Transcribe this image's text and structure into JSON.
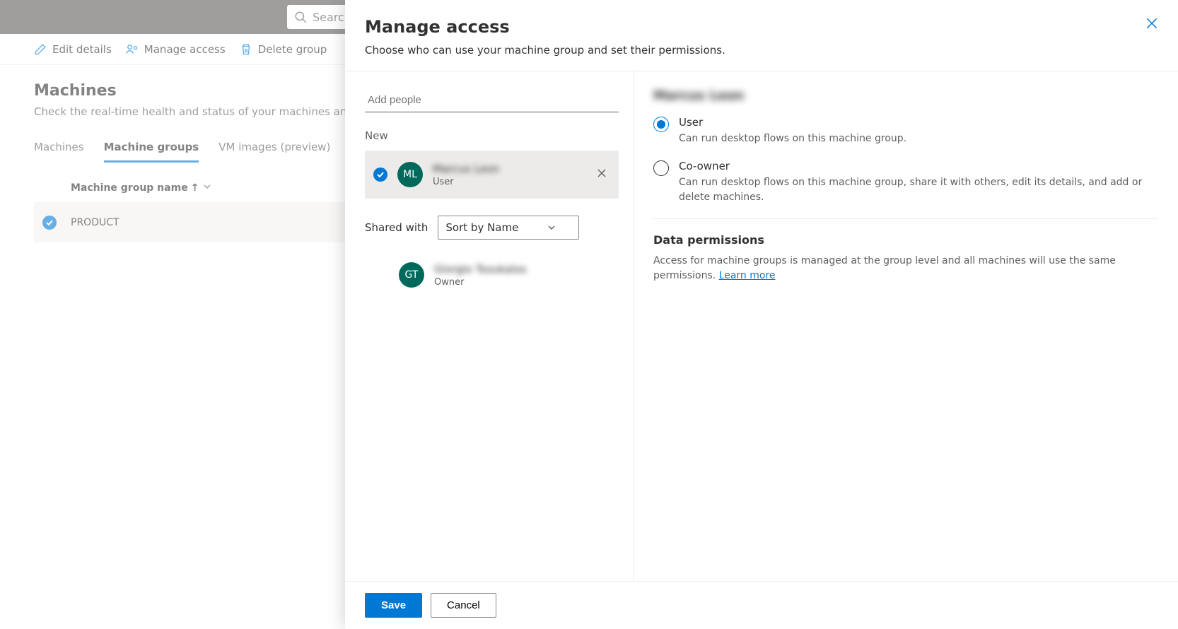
{
  "search": {
    "placeholder": "Search"
  },
  "commandbar": {
    "edit": "Edit details",
    "manage": "Manage access",
    "delete": "Delete group"
  },
  "page": {
    "title": "Machines",
    "subtitle": "Check the real-time health and status of your machines and machine groups."
  },
  "tabs": {
    "machines": "Machines",
    "groups": "Machine groups",
    "vm": "VM images (preview)"
  },
  "table": {
    "col_name": "Machine group name",
    "rows": [
      {
        "name": "PRODUCT"
      }
    ]
  },
  "panel": {
    "title": "Manage access",
    "subtitle": "Choose who can use your machine group and set their permissions.",
    "add_placeholder": "Add people",
    "new_label": "New",
    "shared_with_label": "Shared with",
    "sort_label": "Sort by Name",
    "people_new": [
      {
        "initials": "ML",
        "name": "Marcus Leon",
        "role": "User"
      }
    ],
    "people_shared": [
      {
        "initials": "GT",
        "name": "Giorgio Tsoukalos",
        "role": "Owner"
      }
    ],
    "right": {
      "heading": "Marcus Leon",
      "roles": [
        {
          "label": "User",
          "desc": "Can run desktop flows on this machine group.",
          "selected": true
        },
        {
          "label": "Co-owner",
          "desc": "Can run desktop flows on this machine group, share it with others, edit its details, and add or delete machines.",
          "selected": false
        }
      ],
      "perm_title": "Data permissions",
      "perm_desc": "Access for machine groups is managed at the group level and all machines will use the same permissions. ",
      "learn_more": "Learn more"
    },
    "footer": {
      "save": "Save",
      "cancel": "Cancel"
    }
  }
}
